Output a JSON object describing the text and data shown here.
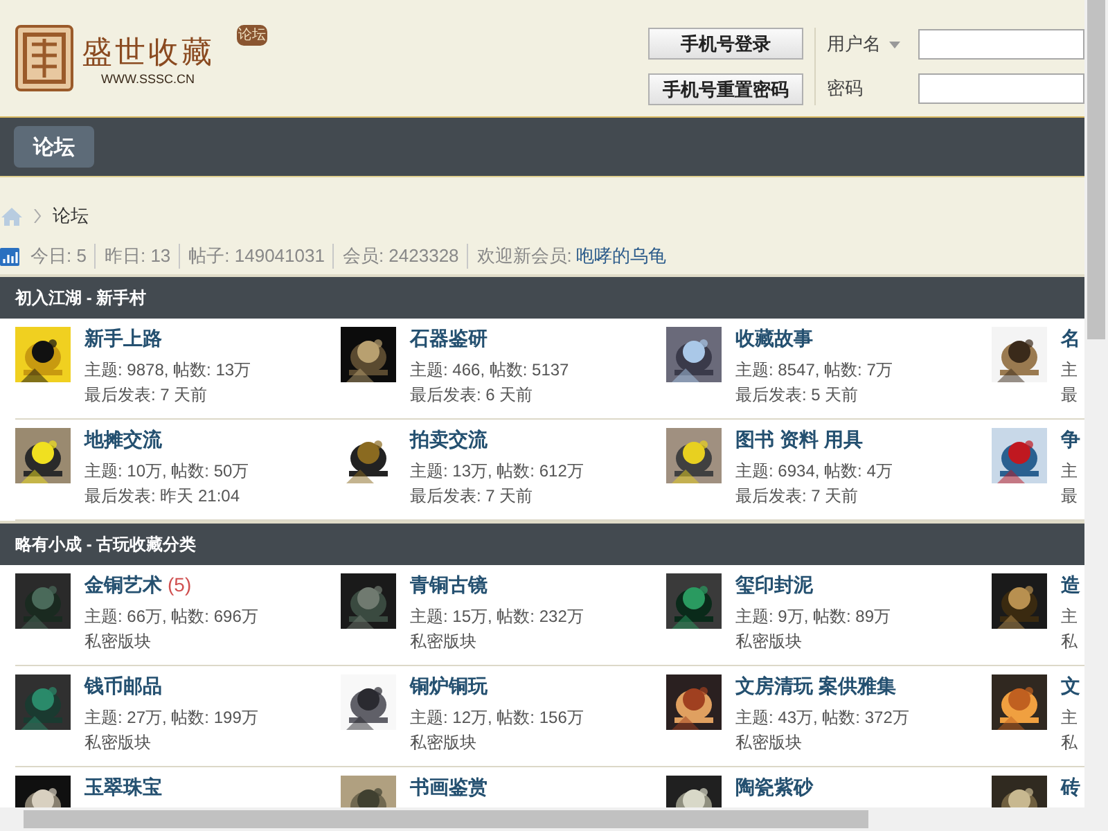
{
  "logo": {
    "name": "盛世收藏",
    "url": "WWW.SSSC.CN",
    "badge": "论坛"
  },
  "login": {
    "buttons": [
      "手机号登录",
      "手机号重置密码"
    ],
    "username_label": "用户名",
    "password_label": "密码"
  },
  "nav": {
    "tabs": [
      {
        "label": "论坛",
        "selected": true
      }
    ]
  },
  "breadcrumb": [
    "论坛"
  ],
  "stats": {
    "items": [
      "今日: 5",
      "昨日: 13",
      "帖子: 149041031",
      "会员: 2423328"
    ],
    "welcome_label": "欢迎新会员:",
    "new_member": "咆哮的乌龟"
  },
  "sections": [
    {
      "title": "初入江湖 - 新手村",
      "forums": [
        {
          "name": "新手上路",
          "stats": "主题: 9878, 帖数: 13万",
          "last": "最后发表: 7 天前"
        },
        {
          "name": "石器鉴研",
          "stats": "主题: 466, 帖数: 5137",
          "last": "最后发表: 6 天前"
        },
        {
          "name": "收藏故事",
          "stats": "主题: 8547, 帖数: 7万",
          "last": "最后发表: 5 天前"
        },
        {
          "name": "名",
          "stats": "主",
          "last": "最"
        },
        {
          "name": "地摊交流",
          "stats": "主题: 10万, 帖数: 50万",
          "last": "最后发表: 昨天 21:04"
        },
        {
          "name": "拍卖交流",
          "stats": "主题: 13万, 帖数: 612万",
          "last": "最后发表: 7 天前"
        },
        {
          "name": "图书 资料 用具",
          "stats": "主题: 6934, 帖数: 4万",
          "last": "最后发表: 7 天前"
        },
        {
          "name": "争",
          "stats": "主",
          "last": "最"
        }
      ]
    },
    {
      "title": "略有小成 - 古玩收藏分类",
      "forums": [
        {
          "name": "金铜艺术",
          "new_count": "(5)",
          "stats": "主题: 66万, 帖数: 696万",
          "last": "私密版块"
        },
        {
          "name": "青铜古镜",
          "stats": "主题: 15万, 帖数: 232万",
          "last": "私密版块"
        },
        {
          "name": "玺印封泥",
          "stats": "主题: 9万, 帖数: 89万",
          "last": "私密版块"
        },
        {
          "name": "造",
          "stats": "主",
          "last": "私"
        },
        {
          "name": "钱币邮品",
          "stats": "主题: 27万, 帖数: 199万",
          "last": "私密版块"
        },
        {
          "name": "铜炉铜玩",
          "stats": "主题: 12万, 帖数: 156万",
          "last": "私密版块"
        },
        {
          "name": "文房清玩 案供雅集",
          "stats": "主题: 43万, 帖数: 372万",
          "last": "私密版块"
        },
        {
          "name": "文",
          "stats": "主",
          "last": "私"
        },
        {
          "name": "玉翠珠宝"
        },
        {
          "name": "书画鉴赏"
        },
        {
          "name": "陶瓷紫砂"
        },
        {
          "name": "砖"
        }
      ]
    }
  ]
}
